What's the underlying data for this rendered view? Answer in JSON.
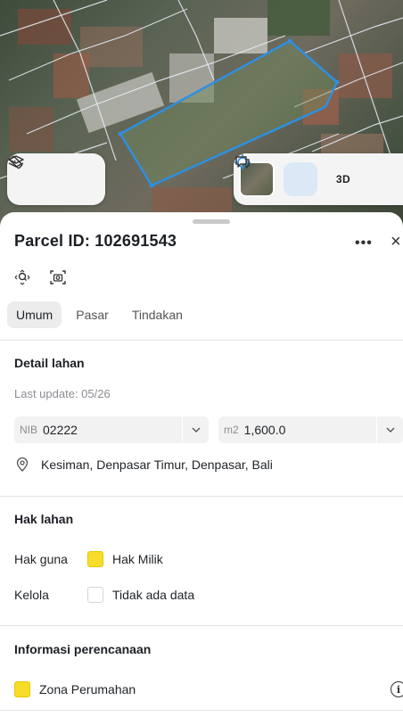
{
  "map": {
    "layers_icon": "layers-icon",
    "measure_icon": "ruler-icon",
    "locate_icon": "crosshair-icon",
    "mode_3d_label": "3D",
    "chat_icon": "chat-icon",
    "parcel_outline_color": "#2f8fe0"
  },
  "sheet": {
    "title": "Parcel ID: 102691543",
    "more_label": "•••",
    "close_label": "×",
    "tabs": [
      {
        "label": "Umum",
        "active": true
      },
      {
        "label": "Pasar",
        "active": false
      },
      {
        "label": "Tindakan",
        "active": false
      }
    ]
  },
  "detail": {
    "title": "Detail lahan",
    "last_update": "Last update: 05/26",
    "nib_prefix": "NIB",
    "nib_value": "02222",
    "area_prefix": "m2",
    "area_value": "1,600.0",
    "address": "Kesiman, Denpasar Timur, Denpasar, Bali"
  },
  "hak": {
    "title": "Hak lahan",
    "rows": [
      {
        "label": "Hak guna",
        "value": "Hak Milik",
        "color": "#f7dc2a"
      },
      {
        "label": "Kelola",
        "value": "Tidak ada data",
        "color": "#ffffff"
      }
    ]
  },
  "planning": {
    "title": "Informasi perencanaan",
    "zone": "Zona Perumahan",
    "zone_color": "#f7dc2a",
    "info_label": "i"
  }
}
